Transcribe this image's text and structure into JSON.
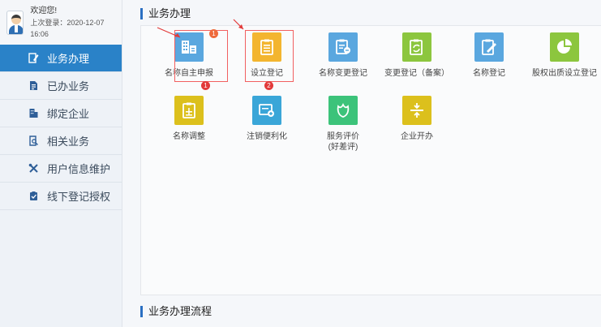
{
  "user": {
    "welcome": "欢迎您!",
    "last_login": "上次登录：2020-12-07 16:06"
  },
  "sidebar": {
    "items": [
      {
        "label": "业务办理",
        "icon": "edit-icon",
        "active": true
      },
      {
        "label": "已办业务",
        "icon": "document-list-icon",
        "active": false
      },
      {
        "label": "绑定企业",
        "icon": "building-icon",
        "active": false
      },
      {
        "label": "相关业务",
        "icon": "search-document-icon",
        "active": false
      },
      {
        "label": "用户信息维护",
        "icon": "tools-icon",
        "active": false
      },
      {
        "label": "线下登记授权",
        "icon": "clipboard-check-icon",
        "active": false
      }
    ]
  },
  "main": {
    "section_title": "业务办理",
    "flow_title": "业务办理流程",
    "tiles": [
      {
        "label": "名称自主申报",
        "color": "#5aa7df",
        "icon": "building-document-icon"
      },
      {
        "label": "设立登记",
        "color": "#f3b52f",
        "icon": "clipboard-icon"
      },
      {
        "label": "名称变更登记",
        "color": "#5aa7df",
        "icon": "clipboard-edit-icon"
      },
      {
        "label": "变更登记（备案）",
        "color": "#8cc63e",
        "icon": "clipboard-refresh-icon"
      },
      {
        "label": "名称登记",
        "color": "#5aa7df",
        "icon": "clipboard-pen-icon"
      },
      {
        "label": "股权出质设立登记",
        "color": "#8cc63e",
        "icon": "pie-chart-icon"
      },
      {
        "label": "名称调整",
        "color": "#dcc01c",
        "icon": "clipboard-adjust-icon"
      },
      {
        "label": "注销便利化",
        "color": "#3aa6d8",
        "icon": "cancel-card-icon"
      },
      {
        "label": "服务评价",
        "label2": "(好差评)",
        "color": "#3cc37a",
        "icon": "flower-icon"
      },
      {
        "label": "企业开办",
        "color": "#dcc01c",
        "icon": "compress-icon"
      }
    ],
    "annotations": {
      "badge1": "1",
      "badge2": "2",
      "arrow_color": "#e23a3a"
    }
  }
}
